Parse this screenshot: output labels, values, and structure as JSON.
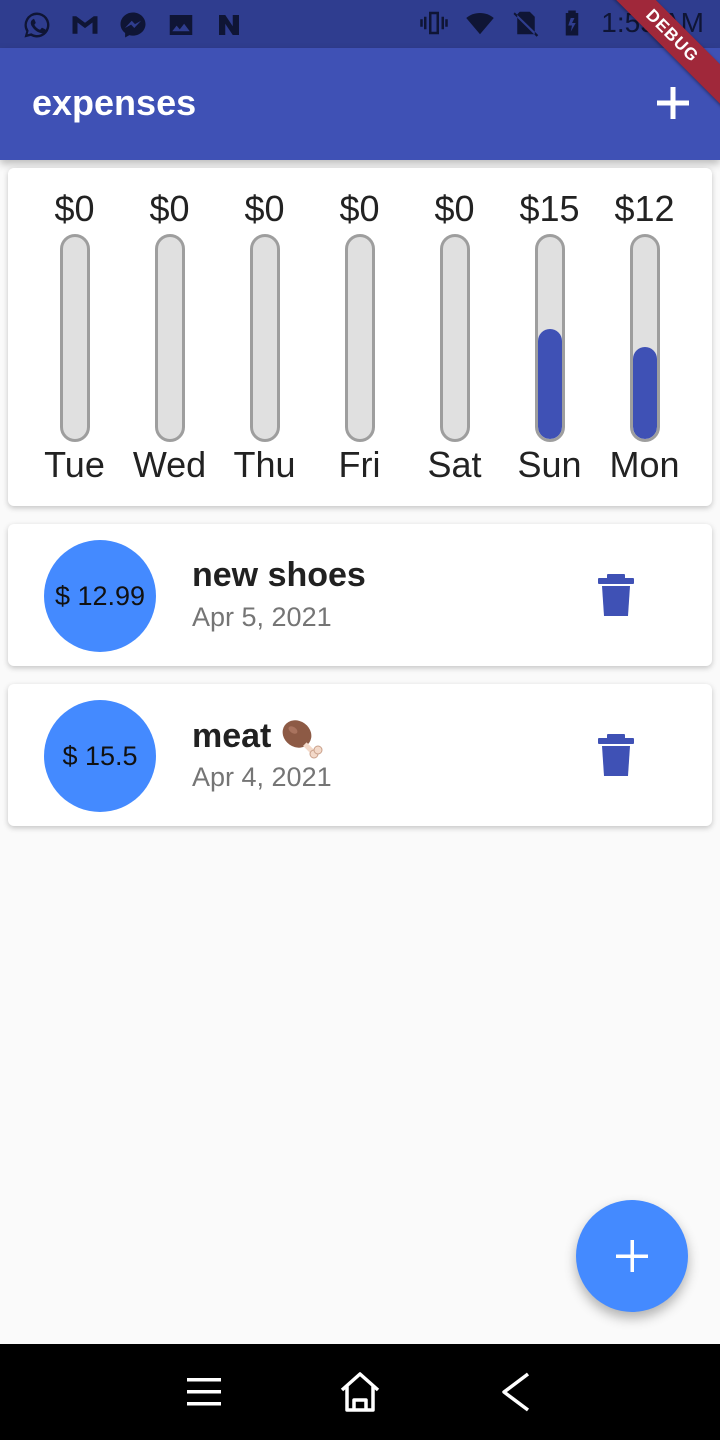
{
  "status_bar": {
    "time": "1:55 AM",
    "left_icons": [
      "whatsapp-icon",
      "gmail-icon",
      "messenger-icon",
      "gallery-icon",
      "n-app-icon"
    ],
    "right_icons": [
      "vibrate-icon",
      "wifi-icon",
      "no-sim-icon",
      "battery-charging-icon"
    ]
  },
  "debug_banner": "DEBUG",
  "app_bar": {
    "title": "expenses",
    "action_icon": "add-icon"
  },
  "chart": {
    "bars": [
      {
        "day": "Tue",
        "amount": "$0",
        "fraction": 0
      },
      {
        "day": "Wed",
        "amount": "$0",
        "fraction": 0
      },
      {
        "day": "Thu",
        "amount": "$0",
        "fraction": 0
      },
      {
        "day": "Fri",
        "amount": "$0",
        "fraction": 0
      },
      {
        "day": "Sat",
        "amount": "$0",
        "fraction": 0
      },
      {
        "day": "Sun",
        "amount": "$15",
        "fraction": 0.544
      },
      {
        "day": "Mon",
        "amount": "$12",
        "fraction": 0.456
      }
    ],
    "fill_color": "#3f51b5",
    "track_color": "#e0e0e0"
  },
  "transactions": [
    {
      "amount": "$ 12.99",
      "title": "new shoes",
      "emoji": "",
      "date": "Apr 5, 2021",
      "delete_icon": "trash-icon"
    },
    {
      "amount": "$ 15.5",
      "title": "meat",
      "emoji": "meat-on-bone-icon",
      "date": "Apr 4, 2021",
      "delete_icon": "trash-icon"
    }
  ],
  "fab": {
    "icon": "add-icon",
    "color": "#448aff"
  },
  "nav_bar": {
    "buttons": [
      "menu-icon",
      "home-icon",
      "back-icon"
    ]
  },
  "colors": {
    "primary": "#3f51b5",
    "accent": "#448aff",
    "status_bar": "#2f3d8f"
  }
}
